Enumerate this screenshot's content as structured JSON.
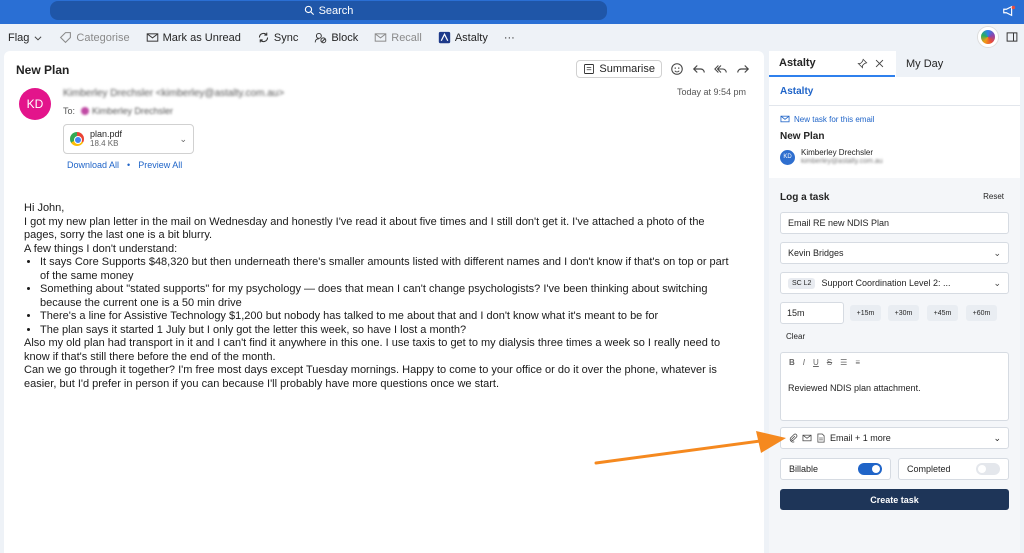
{
  "search": {
    "label": "Search"
  },
  "ribbon": {
    "flag": "Flag",
    "categorise": "Categorise",
    "mark_unread": "Mark as Unread",
    "sync": "Sync",
    "block": "Block",
    "recall": "Recall",
    "astalty": "Astalty",
    "more": "···"
  },
  "email": {
    "subject": "New Plan",
    "summarise": "Summarise",
    "from": "Kimberley Drechsler <kimberley@astalty.com.au>",
    "to_label": "To:",
    "to_name": "Kimberley Drechsler",
    "timestamp": "Today at 9:54 pm",
    "attachment": {
      "name": "plan.pdf",
      "size": "18.4 KB"
    },
    "download_all": "Download All",
    "preview_all": "Preview All",
    "avatar_initials": "KD",
    "greeting": "Hi John,",
    "para1": "I got my new plan letter in the mail on Wednesday and honestly I've read it about five times and I still don't get it. I've attached a photo of the pages, sorry the last one is a bit blurry.",
    "para2": "A few things I don't understand:",
    "bullets": [
      "It says Core Supports $48,320 but then underneath there's smaller amounts listed with different names and I don't know if that's on top or part of the same money",
      "Something about \"stated supports\" for my psychology — does that mean I can't change psychologists? I've been thinking about switching because the current one is a 50 min drive",
      "There's a line for Assistive Technology $1,200 but nobody has talked to me about that and I don't know what it's meant to be for",
      "The plan says it started 1 July but I only got the letter this week, so have I lost a month?"
    ],
    "para3": "Also my old plan had transport in it and I can't find it anywhere in this one. I use taxis to get to my dialysis three times a week so I really need to know if that's still there before the end of the month.",
    "para4": "Can we go through it together? I'm free most days except Tuesday mornings. Happy to come to your office or do it over the phone, whatever is easier, but I'd prefer in person if you can because I'll probably have more questions once we start."
  },
  "addin": {
    "tab_active": "Astalty",
    "tab_other": "My Day",
    "brand": "Astalty",
    "new_task_link": "New task for this email",
    "email_title": "New Plan",
    "contact_name": "Kimberley Drechsler",
    "contact_email": "kimberley@astalty.com.au",
    "contact_initials": "KD",
    "log_title": "Log a task",
    "reset": "Reset",
    "task_title": "Email RE new NDIS Plan",
    "assignee": "Kevin Bridges",
    "support_badge": "SC L2",
    "support_item": "Support Coordination Level 2: ...",
    "minutes": "15m",
    "quick_add": [
      "+15m",
      "+30m",
      "+45m",
      "+60m"
    ],
    "clear": "Clear",
    "editor_tools": [
      "B",
      "I",
      "U",
      "S",
      "☰",
      "≡"
    ],
    "notes": "Reviewed NDIS plan attachment.",
    "attachments": "Email + 1 more",
    "billable_label": "Billable",
    "billable": true,
    "completed_label": "Completed",
    "completed": false,
    "create_button": "Create task"
  },
  "colors": {
    "accent": "#2f80ed",
    "avatar": "#e3148b",
    "create": "#1e3558",
    "arrow": "#f5891f"
  }
}
